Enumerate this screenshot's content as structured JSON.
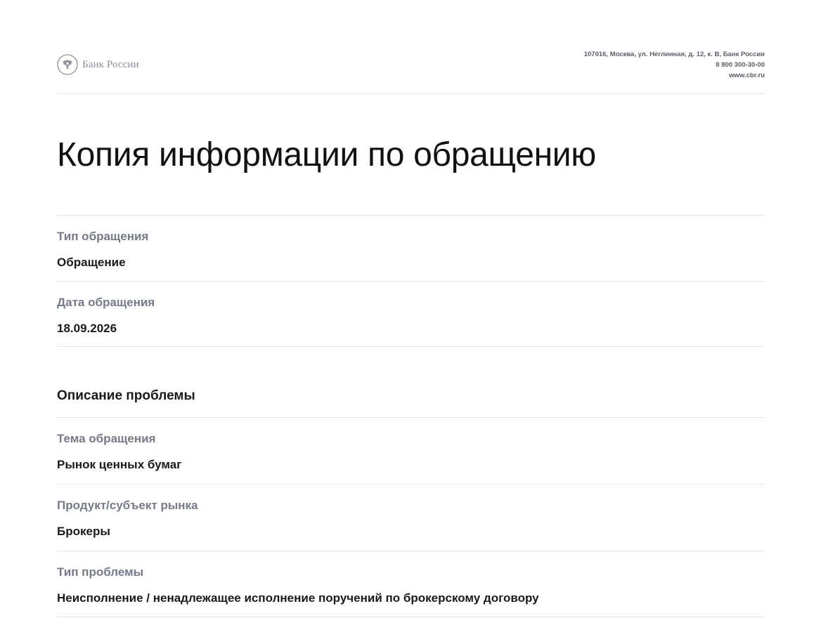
{
  "header": {
    "logo_text": "Банк России",
    "address": "107016, Москва, ул. Неглинная, д. 12, к. В, Банк России",
    "phone": "8 800 300-30-00",
    "website": "www.cbr.ru"
  },
  "document": {
    "title": "Копия информации по обращению"
  },
  "general_fields": [
    {
      "label": "Тип обращения",
      "value": "Обращение"
    },
    {
      "label": "Дата обращения",
      "value": "18.09.2026"
    }
  ],
  "problem_section": {
    "title": "Описание проблемы",
    "fields": [
      {
        "label": "Тема обращения",
        "value": "Рынок ценных бумаг"
      },
      {
        "label": "Продукт/субъект рынка",
        "value": "Брокеры"
      },
      {
        "label": "Тип проблемы",
        "value": "Неисполнение / ненадлежащее исполнение поручений по брокерскому договору"
      }
    ]
  },
  "colors": {
    "divider": "#e2e4e8",
    "label": "#757b86",
    "value": "#1a1a1a",
    "logo": "#8a8f98"
  },
  "icons": {
    "logo_emblem": "double-headed-eagle-emblem-icon"
  }
}
